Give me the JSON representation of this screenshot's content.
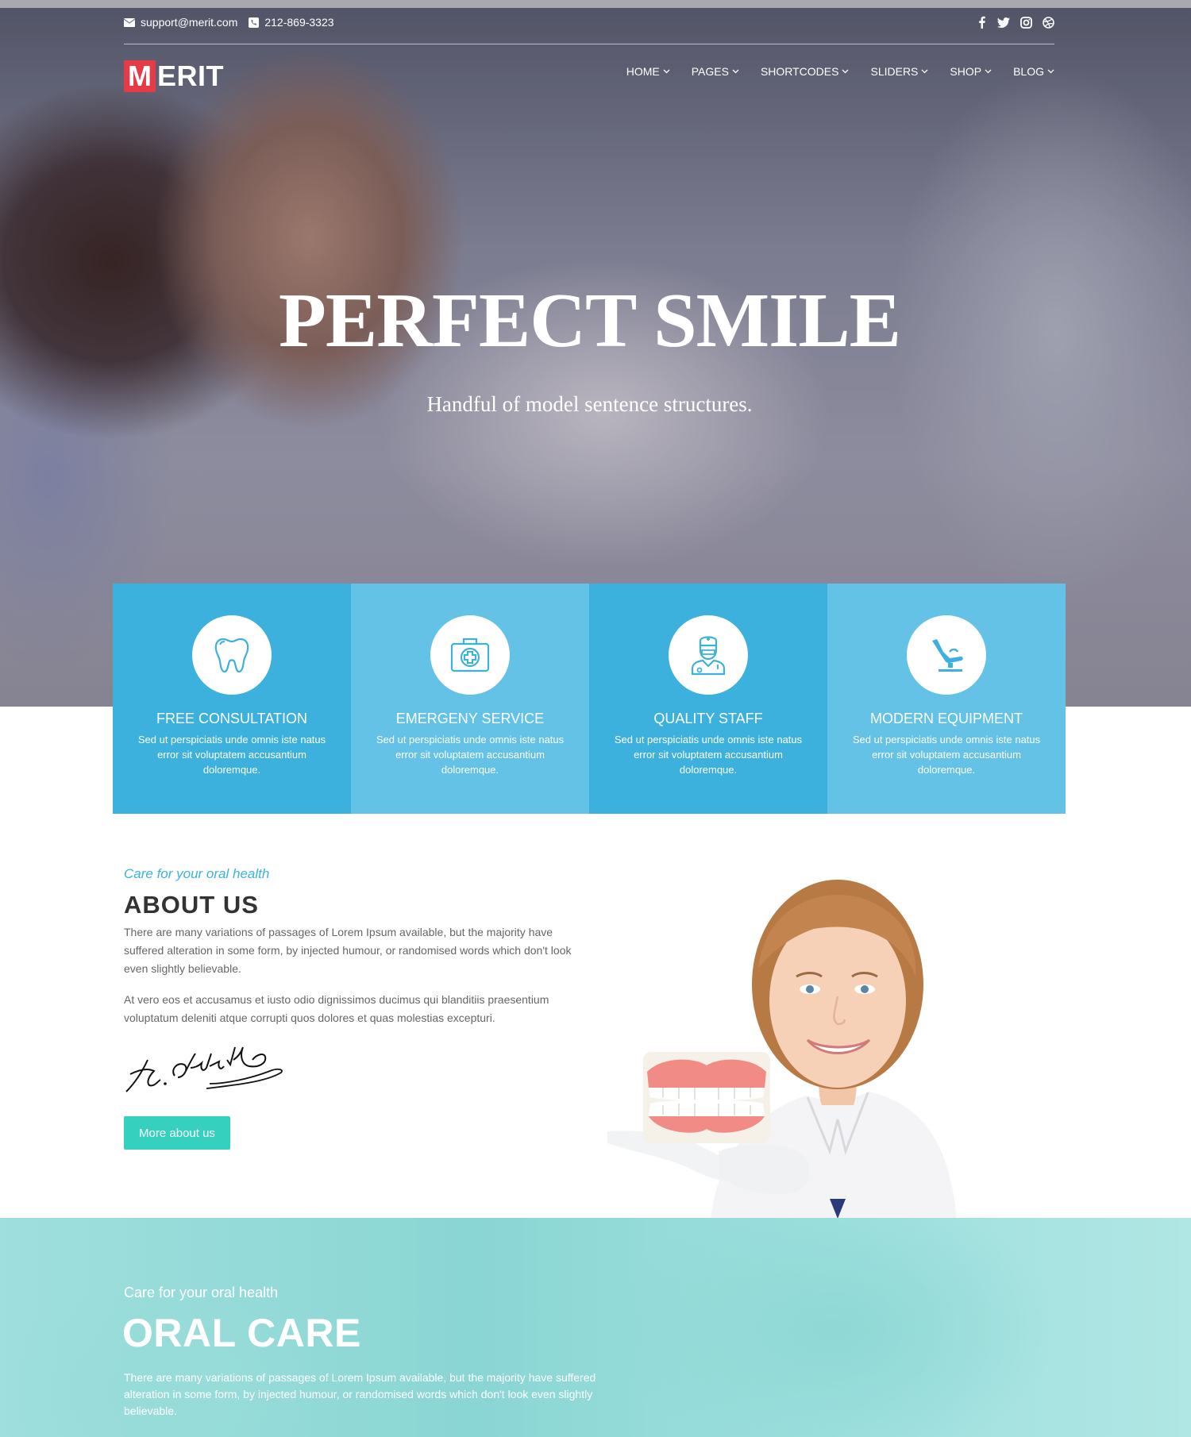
{
  "topbar": {
    "email": "support@merit.com",
    "phone": "212-869-3323",
    "social_icons": [
      "facebook-icon",
      "twitter-icon",
      "instagram-icon",
      "dribbble-icon"
    ]
  },
  "logo": {
    "first_letter": "M",
    "rest": "ERIT"
  },
  "nav": {
    "items": [
      {
        "label": "HOME"
      },
      {
        "label": "PAGES"
      },
      {
        "label": "SHORTCODES"
      },
      {
        "label": "SLIDERS"
      },
      {
        "label": "SHOP"
      },
      {
        "label": "BLOG"
      }
    ]
  },
  "hero": {
    "title": "PERFECT SMILE",
    "subtitle": "Handful of model sentence structures."
  },
  "features": [
    {
      "icon": "tooth-icon",
      "title": "FREE CONSULTATION",
      "desc": "Sed ut perspiciatis unde omnis iste natus error sit voluptatem accusantium doloremque."
    },
    {
      "icon": "first-aid-kit-icon",
      "title": "EMERGENY SERVICE",
      "desc": "Sed ut perspiciatis unde omnis iste natus error sit voluptatem accusantium doloremque."
    },
    {
      "icon": "doctor-icon",
      "title": "QUALITY STAFF",
      "desc": "Sed ut perspiciatis unde omnis iste natus error sit voluptatem accusantium doloremque."
    },
    {
      "icon": "dental-chair-icon",
      "title": "MODERN EQUIPMENT",
      "desc": "Sed ut perspiciatis unde omnis iste natus error sit voluptatem accusantium doloremque."
    }
  ],
  "about": {
    "subtitle": "Care for your oral health",
    "title": "ABOUT US",
    "p1": "There are many variations of passages of Lorem Ipsum available, but the majority have suffered alteration in some form, by injected humour, or randomised words which don't look even slightly believable.",
    "p2": "At vero eos et accusamus et iusto odio dignissimos ducimus qui blanditiis praesentium voluptatum deleniti atque corrupti quos dolores et quas molestias excepturi.",
    "button": "More about us"
  },
  "oral": {
    "subtitle": "Care for your oral health",
    "title": "ORAL CARE",
    "text": "There are many variations of passages of Lorem Ipsum available, but the majority have suffered alteration in some form, by injected humour, or randomised words which don't look even slightly believable."
  },
  "colors": {
    "accent_blue": "#3cb1dd",
    "accent_blue_light": "#63c2e6",
    "accent_teal": "#35d0be",
    "logo_red": "#e63b46"
  }
}
